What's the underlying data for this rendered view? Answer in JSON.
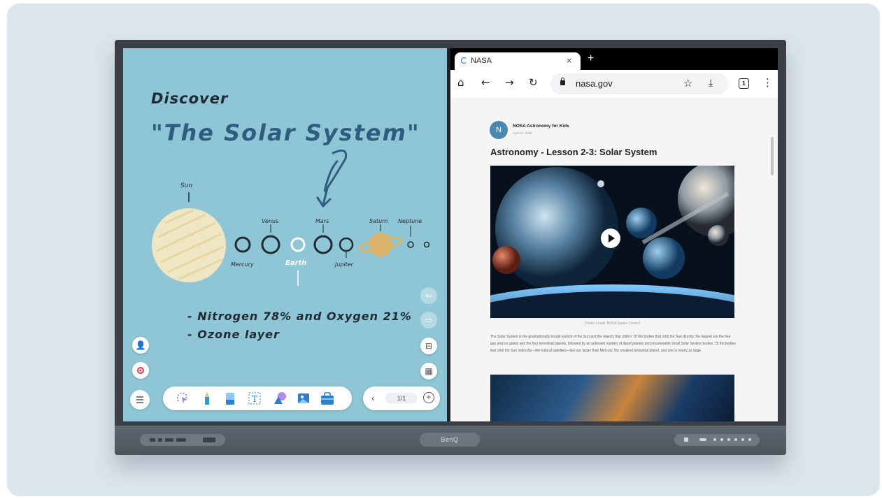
{
  "whiteboard": {
    "title_line1": "Discover",
    "title_line2": "\"The Solar System\"",
    "labels": {
      "sun": "Sun",
      "venus": "Venus",
      "mars": "Mars",
      "saturn": "Saturn",
      "neptune": "Neptune",
      "mercury": "Mercury",
      "earth": "Earth",
      "jupiter": "Jupiter"
    },
    "bullets": [
      "- Nitrogen 78% and Oxygen 21%",
      "- Ozone layer"
    ],
    "page_indicator": "1/1",
    "icons": [
      "add-user-icon",
      "record-icon",
      "menu-icon",
      "lasso-icon",
      "pen-icon",
      "eraser-icon",
      "text-icon",
      "shapes-icon",
      "image-icon",
      "toolbox-icon",
      "undo-icon",
      "redo-icon",
      "split-view-icon",
      "layout-icon",
      "chevron-left-icon",
      "add-page-icon"
    ]
  },
  "browser": {
    "tab_title": "NASA",
    "tab_close": "×",
    "new_tab": "+",
    "url": "nasa.gov",
    "tab_count": "1",
    "article": {
      "avatar_letter": "N",
      "author": "NOSA Astronomy for Kids",
      "date": "April 21, 2023",
      "title": "Astronomy - Lesson 2-3:  Solar System",
      "video_credit": "(Video Credit: NOSA Space Center)",
      "body": "The Solar System is the gravitationally bound system of the Sun and the objects that orbit it. Of the bodies that orbit the Sun directly, the largest are the four gas and ice giants and the four terrestrial planets, followed by an unknown number of dwarf planets and innumerable small Solar System bodies. Of the bodies that orbit the Sun indirectly—the natural satellites—two are larger than Mercury, the smallest terrestrial planet, and one is nearly as large"
    }
  },
  "monitor": {
    "brand": "BenQ"
  },
  "colors": {
    "whiteboard_bg": "#8ec6d5",
    "title_blue": "#2f5d80",
    "saturn": "#d9b36a",
    "sun": "#efe6c4"
  }
}
